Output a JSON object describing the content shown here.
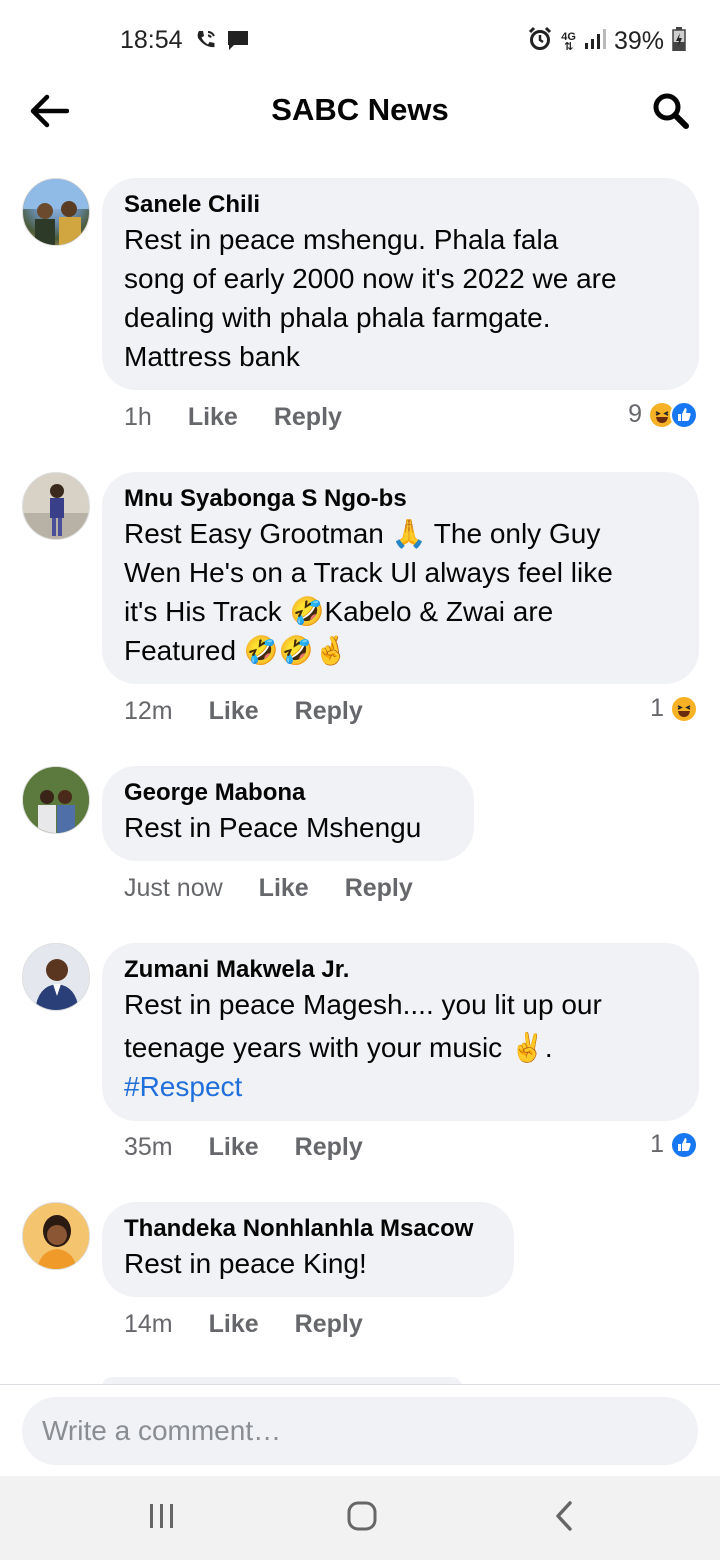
{
  "status_bar": {
    "time": "18:54",
    "network": "4G",
    "battery": "39%"
  },
  "header": {
    "title": "SABC News"
  },
  "comments": [
    {
      "author": "Sanele Chili",
      "lines": [
        "Rest in peace mshengu. Phala fala",
        "song of early 2000 now it's 2022 we are",
        "dealing with phala phala farmgate.",
        "Mattress bank"
      ],
      "time": "1h",
      "like": "Like",
      "reply": "Reply",
      "reaction_count": "9",
      "reactions": [
        "haha",
        "like"
      ]
    },
    {
      "author": "Mnu Syabonga S Ngo-bs",
      "lines": [
        "Rest Easy Grootman 🙏 The only Guy",
        "Wen He's on a Track Ul always feel like",
        "it's His Track 🤣Kabelo & Zwai are",
        "Featured 🤣🤣🤞"
      ],
      "time": "12m",
      "like": "Like",
      "reply": "Reply",
      "reaction_count": "1",
      "reactions": [
        "haha"
      ]
    },
    {
      "author": "George Mabona",
      "lines": [
        "Rest in Peace Mshengu"
      ],
      "time": "Just now",
      "like": "Like",
      "reply": "Reply"
    },
    {
      "author": "Zumani Makwela Jr.",
      "lines": [
        "Rest in peace Magesh.... you lit up our",
        "teenage years with your music ✌️."
      ],
      "hashtag": "#Respect",
      "time": "35m",
      "like": "Like",
      "reply": "Reply",
      "reaction_count": "1",
      "reactions": [
        "like"
      ]
    },
    {
      "author": "Thandeka Nonhlanhla Msacow",
      "lines": [
        "Rest in peace King!"
      ],
      "time": "14m",
      "like": "Like",
      "reply": "Reply"
    }
  ],
  "composer": {
    "placeholder": "Write a comment…"
  },
  "colors": {
    "bubble": "#f0f2f5",
    "meta_text": "#65676b",
    "hashtag": "#216fdb",
    "like_blue": "#1877f2",
    "haha_yellow": "#f7b125"
  }
}
